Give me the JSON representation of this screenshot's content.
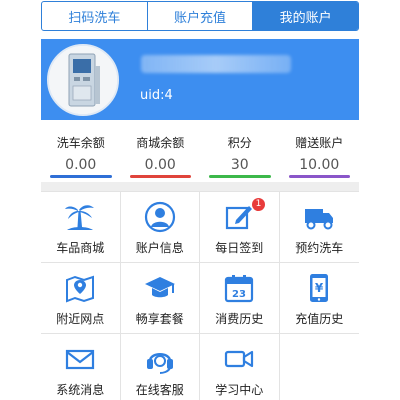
{
  "tabs": [
    {
      "label": "扫码洗车",
      "active": false
    },
    {
      "label": "账户充值",
      "active": false
    },
    {
      "label": "我的账户",
      "active": true
    }
  ],
  "profile": {
    "uid_label": "uid:4"
  },
  "balances": [
    {
      "label": "洗车余额",
      "value": "0.00",
      "color": "#2f6fd6"
    },
    {
      "label": "商城余额",
      "value": "0.00",
      "color": "#e0443b"
    },
    {
      "label": "积分",
      "value": "30",
      "color": "#3cb84a"
    },
    {
      "label": "赠送账户",
      "value": "10.00",
      "color": "#8a56c9"
    }
  ],
  "grid": [
    {
      "label": "车品商城",
      "icon": "palm-island-icon"
    },
    {
      "label": "账户信息",
      "icon": "user-icon"
    },
    {
      "label": "每日签到",
      "icon": "edit-checkin-icon",
      "badge": "1"
    },
    {
      "label": "预约洗车",
      "icon": "truck-icon"
    },
    {
      "label": "附近网点",
      "icon": "map-pin-icon"
    },
    {
      "label": "畅享套餐",
      "icon": "graduation-cap-icon"
    },
    {
      "label": "消费历史",
      "icon": "calendar-icon",
      "calendar_day": "23"
    },
    {
      "label": "充值历史",
      "icon": "yen-phone-icon"
    },
    {
      "label": "系统消息",
      "icon": "mail-icon"
    },
    {
      "label": "在线客服",
      "icon": "headset-icon"
    },
    {
      "label": "学习中心",
      "icon": "video-camera-icon"
    }
  ],
  "colors": {
    "primary": "#2f80d9",
    "banner": "#3d8ef0",
    "icon": "#2f7fe0",
    "badge": "#e83b3b"
  }
}
